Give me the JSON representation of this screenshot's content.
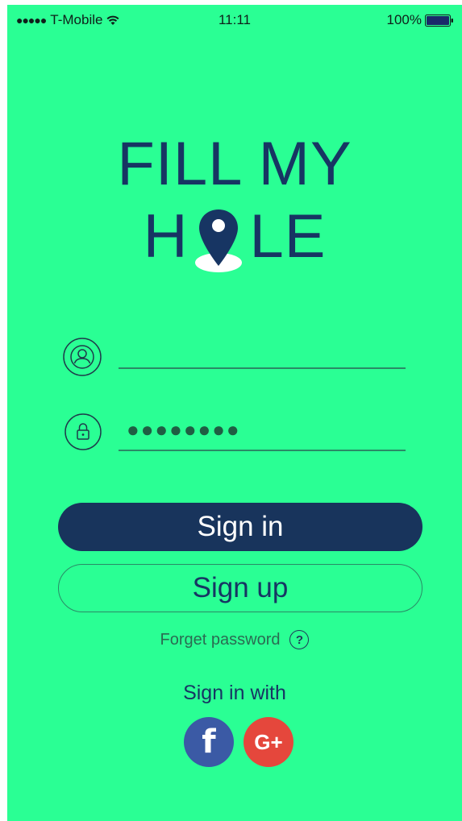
{
  "status_bar": {
    "signal": "●●●●●",
    "carrier": "T-Mobile",
    "time": "11:11",
    "battery_percent": "100%"
  },
  "logo": {
    "line1": "FILL MY",
    "line2_start": "H",
    "line2_end": "LE"
  },
  "form": {
    "username_value": "",
    "password_masked": "●●●●●●●●"
  },
  "buttons": {
    "sign_in": "Sign in",
    "sign_up": "Sign up"
  },
  "forget_password": {
    "label": "Forget password",
    "help_glyph": "?"
  },
  "social": {
    "title": "Sign in with",
    "facebook_glyph": "f",
    "google_glyph": "G+"
  },
  "colors": {
    "background": "#2aff94",
    "brand_navy": "#173563",
    "facebook": "#3b5aa5",
    "google": "#e5473c"
  },
  "icons": [
    "wifi-icon",
    "battery-icon",
    "location-pin-icon",
    "user-icon",
    "lock-icon",
    "help-icon",
    "facebook-icon",
    "google-plus-icon"
  ]
}
